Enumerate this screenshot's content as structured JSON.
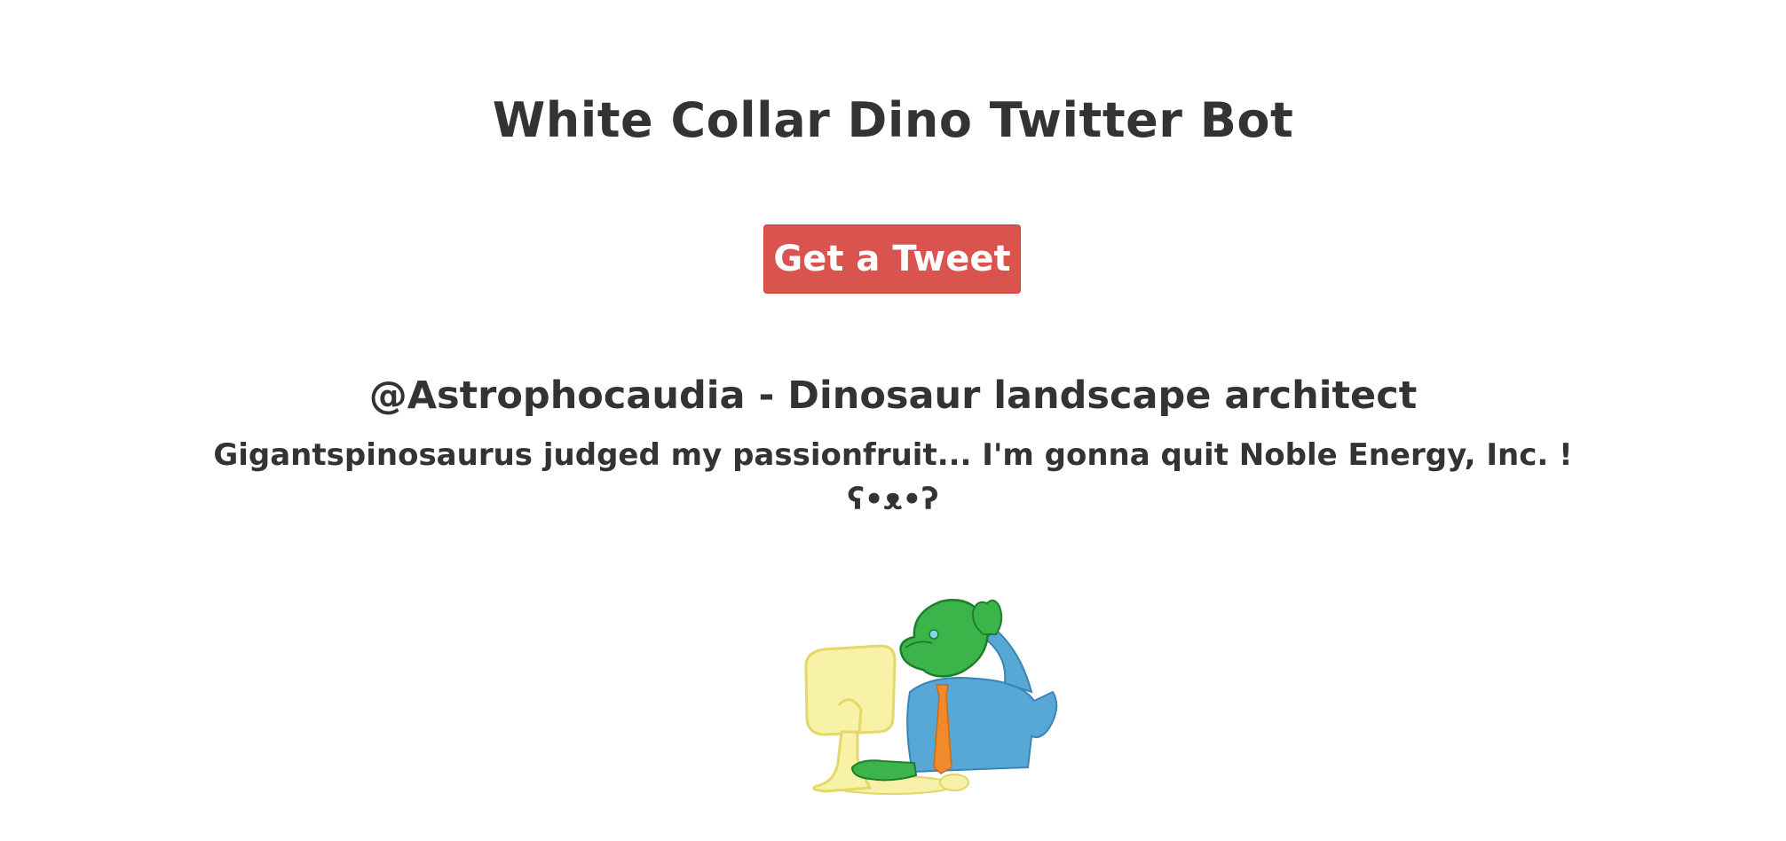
{
  "page": {
    "title": "White Collar Dino Twitter Bot"
  },
  "button": {
    "label": "Get a Tweet"
  },
  "tweet": {
    "author_line": "@Astrophocaudia - Dinosaur landscape architect",
    "text": "Gigantspinosaurus judged my passionfruit... I'm gonna quit Noble Energy, Inc. ! ʕ•ᴥ•ʔ"
  },
  "illustration": {
    "icon": "dinosaur-office-worker-illustration"
  },
  "colors": {
    "button_bg": "#d9534f",
    "text": "#333333",
    "background": "#ffffff"
  }
}
